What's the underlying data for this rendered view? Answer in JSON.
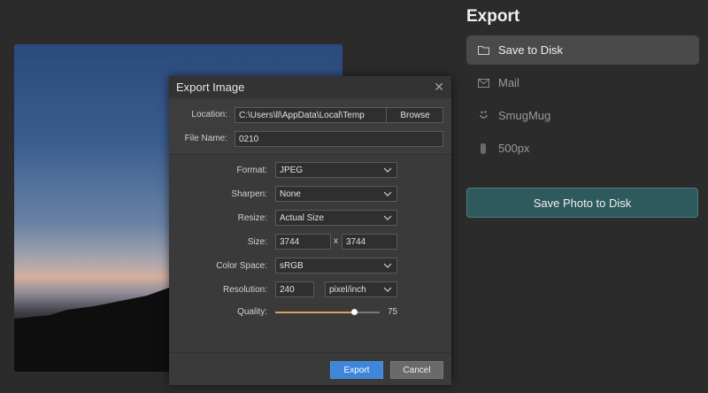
{
  "panel": {
    "title": "Export",
    "destinations": [
      {
        "label": "Save to Disk",
        "icon": "folder-icon",
        "active": true
      },
      {
        "label": "Mail",
        "icon": "mail-icon",
        "active": false
      },
      {
        "label": "SmugMug",
        "icon": "smugmug-icon",
        "active": false
      },
      {
        "label": "500px",
        "icon": "500px-icon",
        "active": false
      }
    ],
    "save_button": "Save Photo to Disk"
  },
  "dialog": {
    "title": "Export Image",
    "location_label": "Location:",
    "location_value": "C:\\Users\\ll\\AppData\\Local\\Temp",
    "browse_label": "Browse",
    "filename_label": "File Name:",
    "filename_value": "0210",
    "format_label": "Format:",
    "format_value": "JPEG",
    "sharpen_label": "Sharpen:",
    "sharpen_value": "None",
    "resize_label": "Resize:",
    "resize_value": "Actual Size",
    "size_label": "Size:",
    "size_width": "3744",
    "size_sep": "x",
    "size_height": "3744",
    "colorspace_label": "Color Space:",
    "colorspace_value": "sRGB",
    "resolution_label": "Resolution:",
    "resolution_value": "240",
    "resolution_unit": "pixel/inch",
    "quality_label": "Quality:",
    "quality_value": "75",
    "quality_fraction": 0.75,
    "export_button": "Export",
    "cancel_button": "Cancel"
  },
  "colors": {
    "accent": "#3d86d8",
    "slider": "#d7a35d",
    "save_button_bg": "#2f5a5d"
  }
}
